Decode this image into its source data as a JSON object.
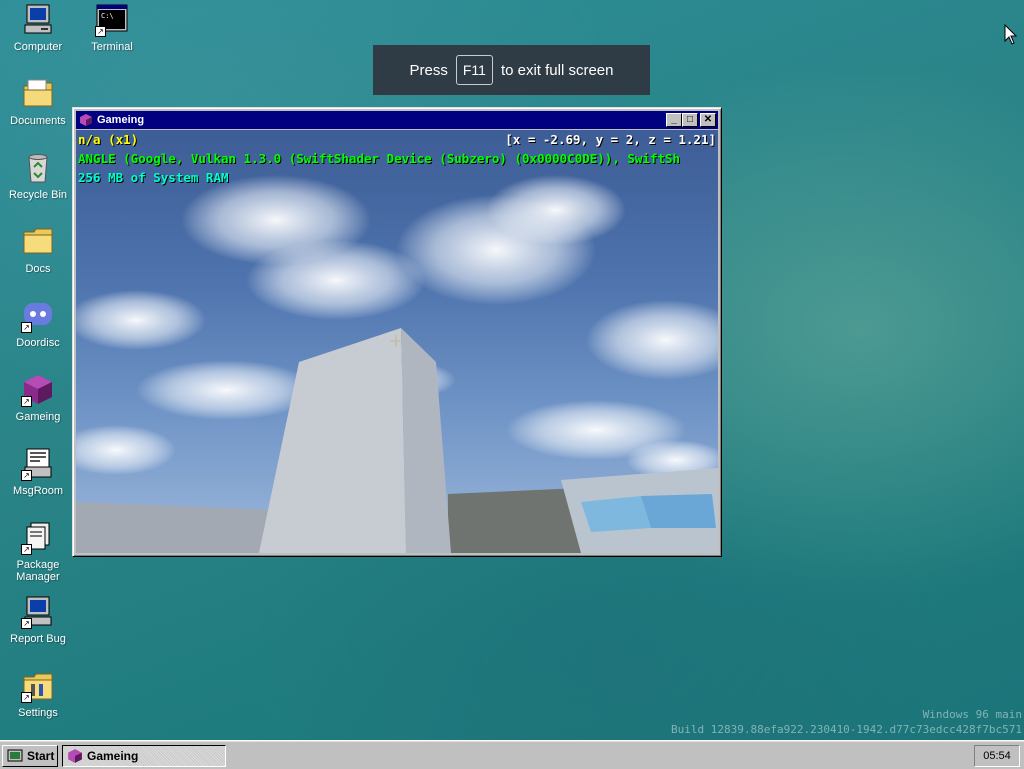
{
  "desktop": {
    "icons": [
      {
        "label": "Computer",
        "icon": "computer-icon"
      },
      {
        "label": "Terminal",
        "icon": "terminal-icon"
      },
      {
        "label": "Documents",
        "icon": "documents-folder-icon"
      },
      {
        "label": "Recycle Bin",
        "icon": "recycle-bin-icon"
      },
      {
        "label": "Docs",
        "icon": "folder-icon"
      },
      {
        "label": "Doordisc",
        "icon": "doordisc-icon"
      },
      {
        "label": "Gameing",
        "icon": "gameing-cube-icon"
      },
      {
        "label": "MsgRoom",
        "icon": "msgroom-icon"
      },
      {
        "label": "Package Manager",
        "icon": "package-manager-icon"
      },
      {
        "label": "Report Bug",
        "icon": "report-bug-icon"
      },
      {
        "label": "Settings",
        "icon": "settings-icon"
      }
    ],
    "watermark": {
      "line1": "Windows 96 main",
      "line2": "Build 12839.88efa922.230410-1942.d77c73edcc428f7bc571"
    }
  },
  "fullscreen_toast": {
    "before": "Press",
    "key": "F11",
    "after": "to exit full screen"
  },
  "window": {
    "title": "Gameing",
    "hud": {
      "status": "n/a (x1)",
      "coords": "[x = -2.69, y = 2, z = 1.21]",
      "renderer": "ANGLE (Google, Vulkan 1.3.0 (SwiftShader Device (Subzero) (0x0000C0DE)), SwiftSh",
      "memory": "256 MB of System RAM"
    },
    "colors": {
      "hud_yellow": "#ffff00",
      "hud_green": "#00ff00",
      "hud_cyan": "#00ffcc"
    }
  },
  "taskbar": {
    "start_label": "Start",
    "task_label": "Gameing",
    "clock": "05:54"
  }
}
